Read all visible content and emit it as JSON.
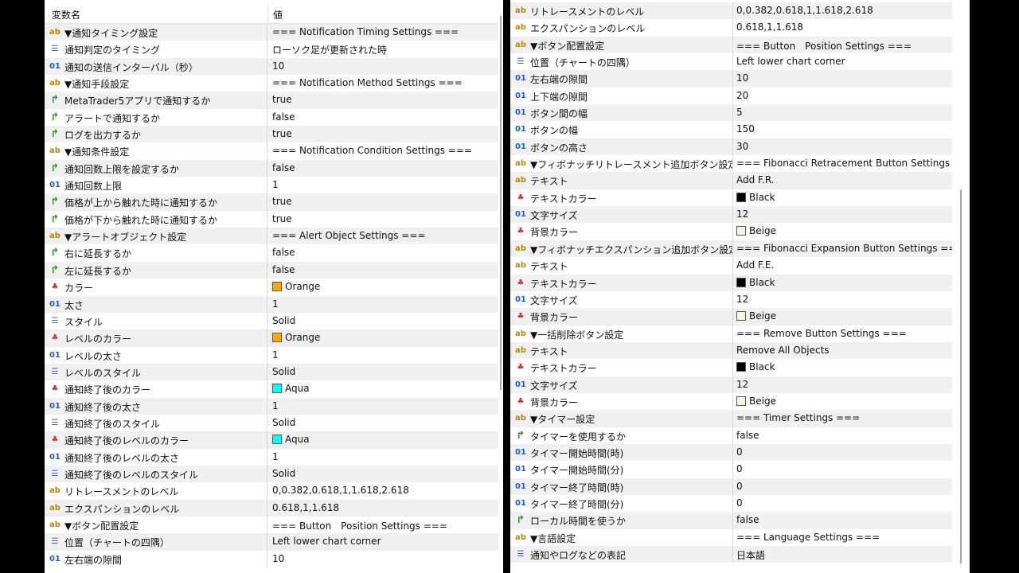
{
  "left": {
    "headers": {
      "name": "変数名",
      "value": "値"
    },
    "rows": [
      {
        "icon": "ab",
        "name": "▼通知タイミング設定",
        "value": "=== Notification Timing Settings ==="
      },
      {
        "icon": "enum",
        "name": "通知判定のタイミング",
        "value": "ローソク足が更新された時"
      },
      {
        "icon": "01",
        "name": "通知の送信インターバル（秒）",
        "value": "10"
      },
      {
        "icon": "ab",
        "name": "▼通知手段設定",
        "value": "=== Notification Method Settings ==="
      },
      {
        "icon": "bool",
        "name": "MetaTrader5アプリで通知するか",
        "value": "true"
      },
      {
        "icon": "bool",
        "name": "アラートで通知するか",
        "value": "false"
      },
      {
        "icon": "bool",
        "name": "ログを出力するか",
        "value": "true"
      },
      {
        "icon": "ab",
        "name": "▼通知条件設定",
        "value": "=== Notification Condition Settings ==="
      },
      {
        "icon": "bool",
        "name": "通知回数上限を設定するか",
        "value": "false"
      },
      {
        "icon": "01",
        "name": "通知回数上限",
        "value": "1"
      },
      {
        "icon": "bool",
        "name": "価格が上から触れた時に通知するか",
        "value": "true"
      },
      {
        "icon": "bool",
        "name": "価格が下から触れた時に通知するか",
        "value": "true"
      },
      {
        "icon": "ab",
        "name": "▼アラートオブジェクト設定",
        "value": "=== Alert Object Settings ==="
      },
      {
        "icon": "bool",
        "name": "右に延長するか",
        "value": "false"
      },
      {
        "icon": "bool",
        "name": "左に延長するか",
        "value": "false"
      },
      {
        "icon": "color",
        "name": "カラー",
        "value": "Orange",
        "swatch": "#FFA500"
      },
      {
        "icon": "01",
        "name": "太さ",
        "value": "1"
      },
      {
        "icon": "enum",
        "name": "スタイル",
        "value": "Solid"
      },
      {
        "icon": "color",
        "name": "レベルのカラー",
        "value": "Orange",
        "swatch": "#FFA500"
      },
      {
        "icon": "01",
        "name": "レベルの太さ",
        "value": "1"
      },
      {
        "icon": "enum",
        "name": "レベルのスタイル",
        "value": "Solid"
      },
      {
        "icon": "color",
        "name": "通知終了後のカラー",
        "value": "Aqua",
        "swatch": "#00FFFF"
      },
      {
        "icon": "01",
        "name": "通知終了後の太さ",
        "value": "1"
      },
      {
        "icon": "enum",
        "name": "通知終了後のスタイル",
        "value": "Solid"
      },
      {
        "icon": "color",
        "name": "通知終了後のレベルのカラー",
        "value": "Aqua",
        "swatch": "#00FFFF"
      },
      {
        "icon": "01",
        "name": "通知終了後のレベルの太さ",
        "value": "1"
      },
      {
        "icon": "enum",
        "name": "通知終了後のレベルのスタイル",
        "value": "Solid"
      },
      {
        "icon": "ab",
        "name": "リトレースメントのレベル",
        "value": "0,0.382,0.618,1,1.618,2.618"
      },
      {
        "icon": "ab",
        "name": "エクスパンションのレベル",
        "value": "0.618,1,1.618"
      },
      {
        "icon": "ab",
        "name": "▼ボタン配置設定",
        "value": "=== Button　Position Settings ==="
      },
      {
        "icon": "enum",
        "name": "位置（チャートの四隅）",
        "value": "Left lower chart corner"
      },
      {
        "icon": "01",
        "name": "左右端の隙間",
        "value": "10"
      }
    ]
  },
  "right": {
    "rows": [
      {
        "icon": "ab",
        "name": "リトレースメントのレベル",
        "value": "0,0.382,0.618,1,1.618,2.618"
      },
      {
        "icon": "ab",
        "name": "エクスパンションのレベル",
        "value": "0.618,1,1.618"
      },
      {
        "icon": "ab",
        "name": "▼ボタン配置設定",
        "value": "=== Button　Position Settings ==="
      },
      {
        "icon": "enum",
        "name": "位置（チャートの四隅）",
        "value": "Left lower chart corner"
      },
      {
        "icon": "01",
        "name": "左右端の隙間",
        "value": "10"
      },
      {
        "icon": "01",
        "name": "上下端の隙間",
        "value": "20"
      },
      {
        "icon": "01",
        "name": "ボタン間の幅",
        "value": "5"
      },
      {
        "icon": "01",
        "name": "ボタンの幅",
        "value": "150"
      },
      {
        "icon": "01",
        "name": "ボタンの高さ",
        "value": "30"
      },
      {
        "icon": "ab",
        "name": "▼フィボナッチリトレースメント追加ボタン設定",
        "value": "=== Fibonacci Retracement Button Settings =..."
      },
      {
        "icon": "ab",
        "name": "テキスト",
        "value": "Add F.R."
      },
      {
        "icon": "color",
        "name": "テキストカラー",
        "value": "Black",
        "swatch": "#000000"
      },
      {
        "icon": "01",
        "name": "文字サイズ",
        "value": "12"
      },
      {
        "icon": "color",
        "name": "背景カラー",
        "value": "Beige",
        "swatch": "#F5F5DC"
      },
      {
        "icon": "ab",
        "name": "▼フィボナッチエクスパンション追加ボタン設定",
        "value": "=== Fibonacci Expansion Button Settings ==="
      },
      {
        "icon": "ab",
        "name": "テキスト",
        "value": "Add F.E."
      },
      {
        "icon": "color",
        "name": "テキストカラー",
        "value": "Black",
        "swatch": "#000000"
      },
      {
        "icon": "01",
        "name": "文字サイズ",
        "value": "12"
      },
      {
        "icon": "color",
        "name": "背景カラー",
        "value": "Beige",
        "swatch": "#F5F5DC"
      },
      {
        "icon": "ab",
        "name": "▼一括削除ボタン設定",
        "value": "=== Remove Button Settings ==="
      },
      {
        "icon": "ab",
        "name": "テキスト",
        "value": "Remove All Objects"
      },
      {
        "icon": "color",
        "name": "テキストカラー",
        "value": "Black",
        "swatch": "#000000"
      },
      {
        "icon": "01",
        "name": "文字サイズ",
        "value": "12"
      },
      {
        "icon": "color",
        "name": "背景カラー",
        "value": "Beige",
        "swatch": "#F5F5DC"
      },
      {
        "icon": "ab",
        "name": "▼タイマー設定",
        "value": "=== Timer Settings ==="
      },
      {
        "icon": "bool",
        "name": "タイマーを使用するか",
        "value": "false"
      },
      {
        "icon": "01",
        "name": "タイマー開始時間(時)",
        "value": "0"
      },
      {
        "icon": "01",
        "name": "タイマー開始時間(分)",
        "value": "0"
      },
      {
        "icon": "01",
        "name": "タイマー終了時間(時)",
        "value": "0"
      },
      {
        "icon": "01",
        "name": "タイマー終了時間(分)",
        "value": "0"
      },
      {
        "icon": "bool",
        "name": "ローカル時間を使うか",
        "value": "false"
      },
      {
        "icon": "ab",
        "name": "▼言語設定",
        "value": "=== Language Settings ==="
      },
      {
        "icon": "enum",
        "name": "通知やログなどの表記",
        "value": "日本語"
      }
    ]
  },
  "icon_glyphs": {
    "ab": "ab",
    "01": "01",
    "bool": "↱",
    "enum": "☰",
    "color": "♣"
  },
  "icon_names": {
    "ab": "string-type-icon",
    "01": "integer-type-icon",
    "bool": "boolean-type-icon",
    "enum": "enum-type-icon",
    "color": "color-type-icon"
  }
}
